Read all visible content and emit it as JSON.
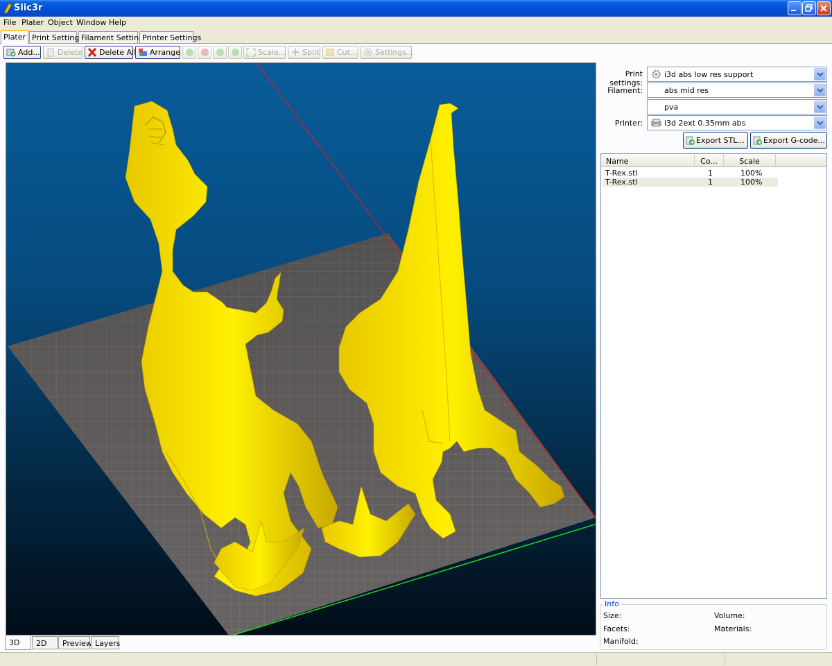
{
  "window": {
    "title": "Slic3r"
  },
  "menu": [
    "File",
    "Plater",
    "Object",
    "Window",
    "Help"
  ],
  "tabs": [
    "Plater",
    "Print Settings",
    "Filament Settings",
    "Printer Settings"
  ],
  "toolbar": {
    "add": "Add...",
    "delete": "Delete",
    "delete_all": "Delete All",
    "arrange": "Arrange",
    "scale": "Scale...",
    "split": "Split",
    "cut": "Cut...",
    "settings": "Settings..."
  },
  "view_tabs": [
    "3D",
    "2D",
    "Preview",
    "Layers"
  ],
  "settings": {
    "print_label": "Print settings:",
    "print_value": "i3d abs low res support",
    "filament_label": "Filament:",
    "filament_values": [
      "abs mid res",
      "pva"
    ],
    "printer_label": "Printer:",
    "printer_value": "i3d 2ext 0.35mm abs"
  },
  "export": {
    "stl": "Export STL...",
    "gcode": "Export G-code..."
  },
  "object_list": {
    "columns": [
      "Name",
      "Co...",
      "Scale"
    ],
    "rows": [
      {
        "name": "T-Rex.stl",
        "copies": "1",
        "scale": "100%"
      },
      {
        "name": "T-Rex.stl",
        "copies": "1",
        "scale": "100%"
      }
    ]
  },
  "info": {
    "title": "Info",
    "size_label": "Size:",
    "volume_label": "Volume:",
    "facets_label": "Facets:",
    "materials_label": "Materials:",
    "manifold_label": "Manifold:"
  },
  "colors": {
    "model_yellow": "#f0d800",
    "bed_grey": "#6d6b6b",
    "sky_top": "#085c9a",
    "axis_x": "#d81e1e",
    "axis_y": "#1ed81e"
  }
}
